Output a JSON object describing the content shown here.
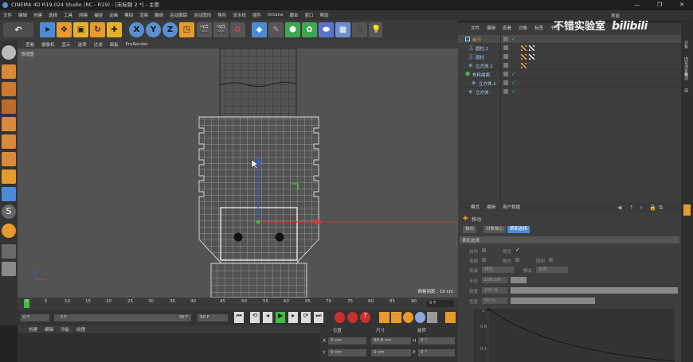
{
  "window": {
    "title": "CINEMA 4D R19.024 Studio (RC - R19) - [未标题 2 *] - 主要",
    "controls": [
      "—",
      "❐",
      "✕"
    ]
  },
  "menubar": [
    "文件",
    "编辑",
    "创建",
    "选择",
    "工具",
    "网格",
    "捕捉",
    "动画",
    "模拟",
    "渲染",
    "雕刻",
    "运动跟踪",
    "运动图形",
    "角色",
    "流水线",
    "插件",
    "Octane",
    "脚本",
    "窗口",
    "帮助"
  ],
  "layout_label": "界面",
  "toolbar": {
    "axis_x": "X",
    "axis_y": "Y",
    "axis_z": "Z"
  },
  "viewport": {
    "menu": [
      "查看",
      "摄像机",
      "显示",
      "选项",
      "过滤",
      "面板",
      "ProRender"
    ],
    "label": "顶视图",
    "grid_info": "网格间距 : 10 cm"
  },
  "timeline": {
    "ticks": [
      "0",
      "5",
      "10",
      "15",
      "20",
      "25",
      "30",
      "35",
      "40",
      "45",
      "50",
      "55",
      "60",
      "65",
      "70",
      "75",
      "80",
      "85",
      "90"
    ],
    "current_frame": "0 F",
    "start_frame": "0 F",
    "end_frame": "90 F",
    "range_min": "0 F",
    "range_max": "90 F"
  },
  "material_menu": [
    "创建",
    "编辑",
    "功能",
    "纹理"
  ],
  "coords": {
    "headers": [
      "位置",
      "尺寸",
      "旋转"
    ],
    "rows": [
      {
        "axis": "X",
        "pos": "0 cm",
        "size": "96.8 cm",
        "rot_axis": "H",
        "rot": "0 °"
      },
      {
        "axis": "Y",
        "pos": "0 cm",
        "size": "0 cm",
        "rot_axis": "P",
        "rot": "0 °"
      }
    ]
  },
  "object_manager": {
    "menu": [
      "文件",
      "编辑",
      "查看",
      "对象",
      "标签",
      "书签"
    ],
    "objects": [
      {
        "name": "细节",
        "indent": 0,
        "selected": true
      },
      {
        "name": "圆柱.1",
        "indent": 1,
        "selected": false
      },
      {
        "name": "圆柱",
        "indent": 1,
        "selected": false
      },
      {
        "name": "立方体.1",
        "indent": 1,
        "selected": false
      },
      {
        "name": "布料曲面",
        "indent": 0,
        "selected": false
      },
      {
        "name": "立方体.1",
        "indent": 2,
        "selected": false
      },
      {
        "name": "立方体",
        "indent": 1,
        "selected": false
      }
    ]
  },
  "attributes": {
    "menu": [
      "模式",
      "编辑",
      "用户数据"
    ],
    "tool_name": "移动",
    "tabs": [
      "轴向",
      "对象轴心",
      "柔和选择"
    ],
    "section": "柔和选择",
    "labels": {
      "enable": "启用",
      "preview": "预览",
      "surface": "表面",
      "rubber": "橡皮",
      "limit": "限制",
      "mode": "衰减",
      "mode_value": "线性",
      "mode2": "模式",
      "mode2_value": "全部",
      "radius": "半径",
      "radius_value": "100 cm",
      "strength": "强度",
      "strength_value": "100 %",
      "width": "宽度",
      "width_value": "50 %"
    },
    "graph_labels": [
      "1",
      "0.8",
      "0.4"
    ]
  },
  "right_strip": [
    "对象",
    "内容浏览器",
    "构造",
    "层"
  ],
  "watermark": {
    "text": "不错实验室",
    "brand": "bilibili"
  },
  "colors": {
    "accent_blue": "#4b8bd6",
    "selection_orange": "#e79b2c",
    "axis_red": "#d23a3a",
    "axis_green": "#3fbf3f",
    "axis_blue": "#3a5bd2",
    "mesh_line": "#dcdcdc"
  }
}
